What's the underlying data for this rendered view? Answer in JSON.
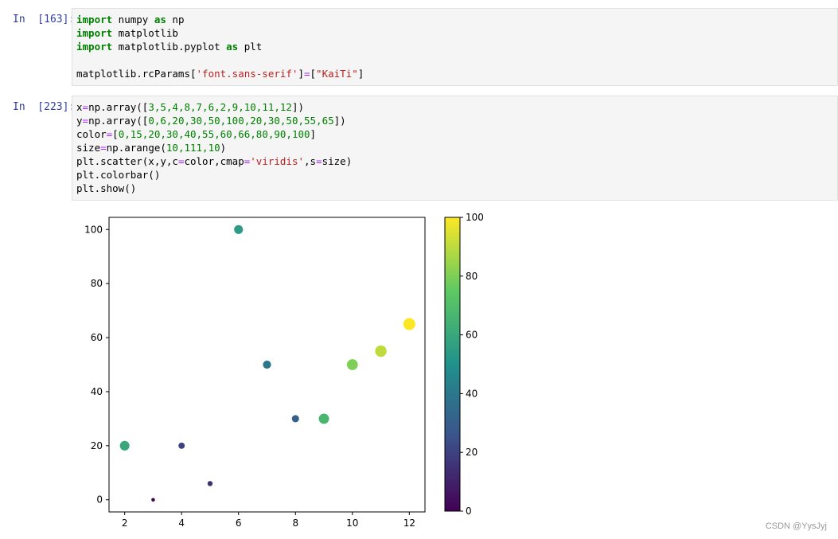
{
  "cells": [
    {
      "prompt": "In  [163]:",
      "lines": [
        [
          {
            "t": "kw",
            "v": "import"
          },
          {
            "t": "",
            "v": " numpy "
          },
          {
            "t": "kw",
            "v": "as"
          },
          {
            "t": "",
            "v": " np"
          }
        ],
        [
          {
            "t": "kw",
            "v": "import"
          },
          {
            "t": "",
            "v": " matplotlib"
          }
        ],
        [
          {
            "t": "kw",
            "v": "import"
          },
          {
            "t": "",
            "v": " matplotlib.pyplot "
          },
          {
            "t": "kw",
            "v": "as"
          },
          {
            "t": "",
            "v": " plt"
          }
        ],
        [],
        [
          {
            "t": "",
            "v": "matplotlib.rcParams["
          },
          {
            "t": "str",
            "v": "'font.sans-serif'"
          },
          {
            "t": "",
            "v": "]"
          },
          {
            "t": "op",
            "v": "="
          },
          {
            "t": "",
            "v": "["
          },
          {
            "t": "str",
            "v": "\"KaiTi\""
          },
          {
            "t": "",
            "v": "]"
          }
        ]
      ]
    },
    {
      "prompt": "In  [223]:",
      "lines": [
        [
          {
            "t": "",
            "v": "x"
          },
          {
            "t": "op",
            "v": "="
          },
          {
            "t": "",
            "v": "np.array(["
          },
          {
            "t": "num",
            "v": "3,5,4,8,7,6,2,9,10,11,12"
          },
          {
            "t": "",
            "v": "])"
          }
        ],
        [
          {
            "t": "",
            "v": "y"
          },
          {
            "t": "op",
            "v": "="
          },
          {
            "t": "",
            "v": "np.array(["
          },
          {
            "t": "num",
            "v": "0,6,20,30,50,100,20,30,50,55,65"
          },
          {
            "t": "",
            "v": "])"
          }
        ],
        [
          {
            "t": "",
            "v": "color"
          },
          {
            "t": "op",
            "v": "="
          },
          {
            "t": "",
            "v": "["
          },
          {
            "t": "num",
            "v": "0,15,20,30,40,55,60,66,80,90,100"
          },
          {
            "t": "",
            "v": "]"
          }
        ],
        [
          {
            "t": "",
            "v": "size"
          },
          {
            "t": "op",
            "v": "="
          },
          {
            "t": "",
            "v": "np.arange("
          },
          {
            "t": "num",
            "v": "10,111,10"
          },
          {
            "t": "",
            "v": ")"
          }
        ],
        [
          {
            "t": "",
            "v": "plt.scatter(x,y,c"
          },
          {
            "t": "op",
            "v": "="
          },
          {
            "t": "",
            "v": "color,cmap"
          },
          {
            "t": "op",
            "v": "="
          },
          {
            "t": "str",
            "v": "'viridis'"
          },
          {
            "t": "",
            "v": ",s"
          },
          {
            "t": "op",
            "v": "="
          },
          {
            "t": "",
            "v": "size)"
          }
        ],
        [
          {
            "t": "",
            "v": "plt.colorbar()"
          }
        ],
        [
          {
            "t": "",
            "v": "plt.show()"
          }
        ]
      ]
    }
  ],
  "chart_data": {
    "type": "scatter",
    "x": [
      3,
      5,
      4,
      8,
      7,
      6,
      2,
      9,
      10,
      11,
      12
    ],
    "y": [
      0,
      6,
      20,
      30,
      50,
      100,
      20,
      30,
      50,
      55,
      65
    ],
    "color": [
      0,
      15,
      20,
      30,
      40,
      55,
      60,
      66,
      80,
      90,
      100
    ],
    "size": [
      10,
      20,
      30,
      40,
      50,
      60,
      70,
      80,
      90,
      100,
      110
    ],
    "cmap": "viridis",
    "xlim": [
      1.45,
      12.55
    ],
    "ylim": [
      -4.5,
      104.5
    ],
    "xticks": [
      2,
      4,
      6,
      8,
      10,
      12
    ],
    "yticks": [
      0,
      20,
      40,
      60,
      80,
      100
    ],
    "colorbar": {
      "range": [
        0,
        100
      ],
      "ticks": [
        0,
        20,
        40,
        60,
        80,
        100
      ]
    },
    "grid": false,
    "title": "",
    "xlabel": "",
    "ylabel": ""
  },
  "watermark": "CSDN @YysJyj"
}
